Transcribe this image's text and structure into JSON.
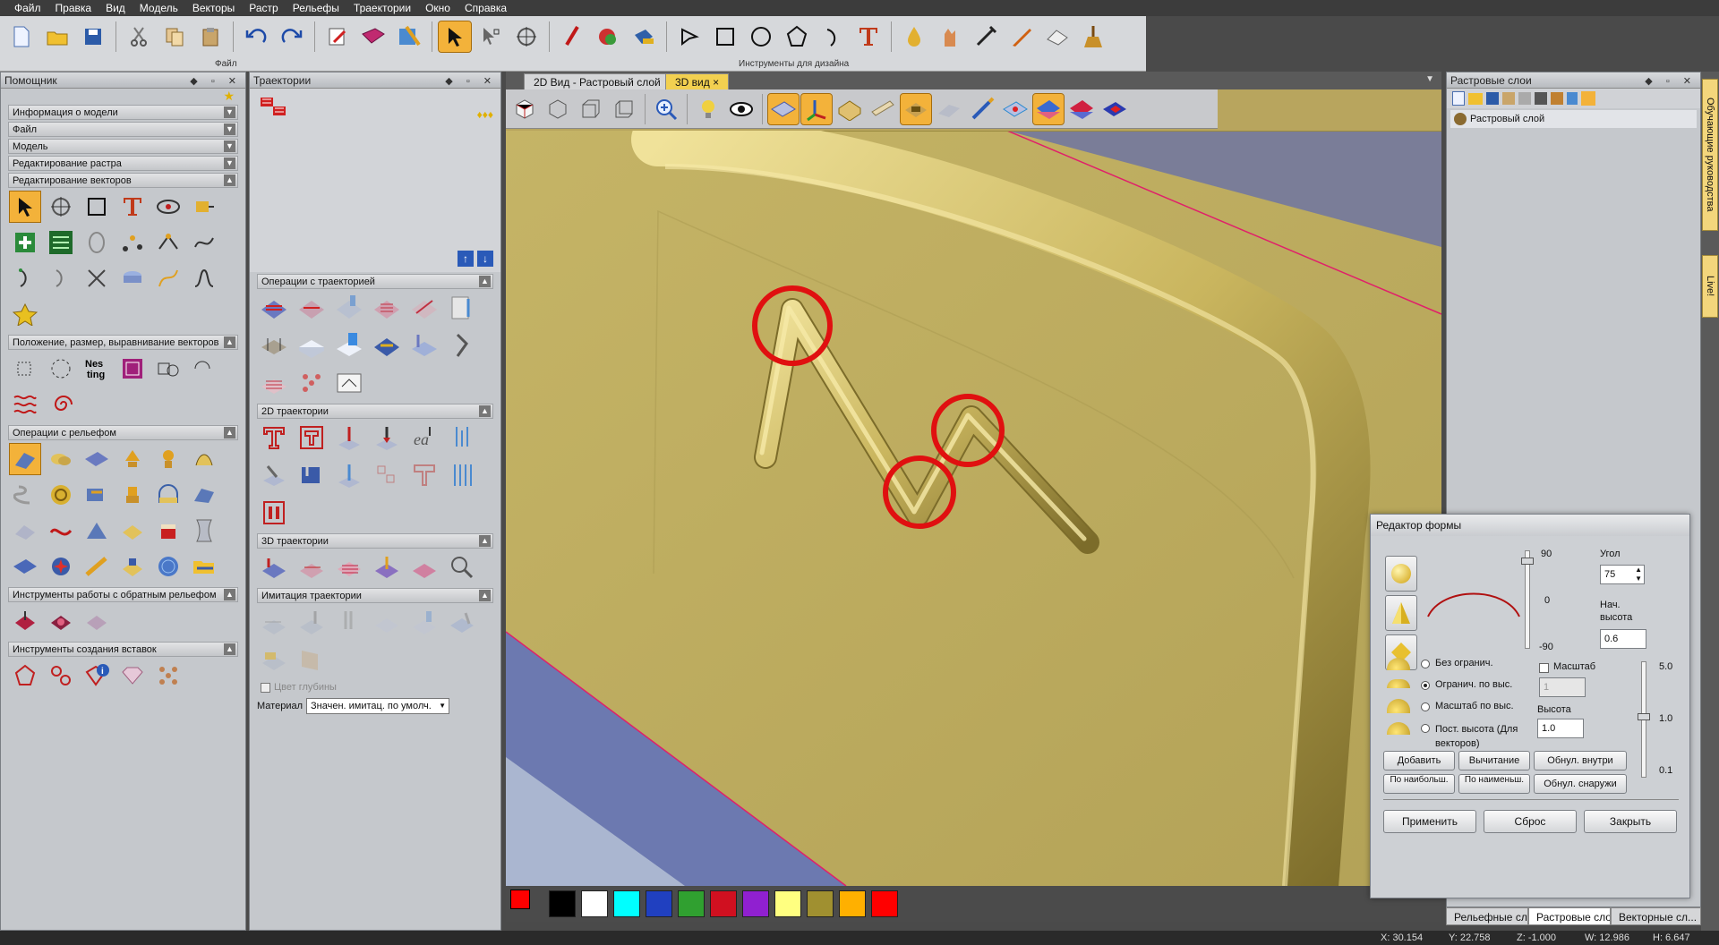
{
  "menu": [
    "Файл",
    "Правка",
    "Вид",
    "Модель",
    "Векторы",
    "Растр",
    "Рельефы",
    "Траектории",
    "Окно",
    "Справка"
  ],
  "toolbar": {
    "group_file": "Файл",
    "group_design": "Инструменты для дизайна",
    "file_icons": [
      "new-file-icon",
      "open-folder-icon",
      "save-icon",
      "cut-icon",
      "copy-icon",
      "paste-icon",
      "undo-icon",
      "redo-icon",
      "edit-icon",
      "book-icon",
      "scissors-texture-icon"
    ],
    "design_icons": [
      "select-arrow-icon",
      "node-edit-icon",
      "transform-icon",
      "pen-icon",
      "paint-icon",
      "fill-icon",
      "polyline-icon",
      "rectangle-icon",
      "circle-icon",
      "polygon-icon",
      "arc-icon",
      "text-icon",
      "drop-icon",
      "hand-icon",
      "pipette-icon",
      "knife-icon",
      "eraser-icon",
      "broom-icon"
    ]
  },
  "helper_panel": {
    "title": "Помощник",
    "sections": [
      "Информация о модели",
      "Файл",
      "Модель",
      "Редактирование растра",
      "Редактирование векторов",
      "Положение, размер, выравнивание векторов",
      "Операции с рельефом",
      "Инструменты работы с обратным рельефом",
      "Инструменты создания вставок"
    ]
  },
  "toolpath_panel": {
    "title": "Траектории",
    "sections": [
      "Операции с траекторией",
      "2D траектории",
      "3D траектории",
      "Имитация траектории"
    ],
    "depth_color_label": "Цвет глубины",
    "material_label": "Материал",
    "material_value": "Значен. имитац. по умолч."
  },
  "tabs": {
    "tab1": "2D Вид - Растровый слой",
    "tab2": "3D вид",
    "close": "×"
  },
  "raster_panel": {
    "title": "Растровые слои",
    "layer": "Растровый слой"
  },
  "side_tabs": {
    "tab1": "Обучающие руководства",
    "tab2": "Live!"
  },
  "bottom_tabs": [
    "Рельефные сл...",
    "Растровые слои",
    "Векторные сл..."
  ],
  "shape_editor": {
    "title": "Редактор формы",
    "angle_label": "Угол",
    "angle_value": "75",
    "start_height_label": "Нач. высота",
    "start_height_value": "0.6",
    "scale_top": "90",
    "scale_mid": "0",
    "scale_bot": "-90",
    "opt1": "Без огранич.",
    "opt2": "Огранич. по выс.",
    "opt3": "Масштаб по выс.",
    "opt4": "Пост. высота (Для векторов)",
    "scale_check": "Масштаб",
    "scale_value": "1",
    "height_label": "Высота",
    "height_value": "1.0",
    "slider_top": "5.0",
    "slider_mid": "1.0",
    "slider_bot": "0.1",
    "btn_add": "Добавить",
    "btn_sub": "Вычитание",
    "btn_zero_in": "Обнул. внутри",
    "btn_max": "По наибольш.",
    "btn_min": "По наименьш.",
    "btn_zero_out": "Обнул. снаружи",
    "btn_apply": "Применить",
    "btn_reset": "Сброс",
    "btn_close": "Закрыть"
  },
  "palette": [
    "#000000",
    "#ffffff",
    "#00ffff",
    "#2040c0",
    "#30a030",
    "#d01020",
    "#9020d0",
    "#ffff80",
    "#a09030",
    "#ffb000",
    "#ff0000"
  ],
  "status": {
    "x": "X: 30.154",
    "y": "Y: 22.758",
    "z": "Z: -1.000",
    "w": "W: 12.986",
    "h": "H: 6.647"
  }
}
